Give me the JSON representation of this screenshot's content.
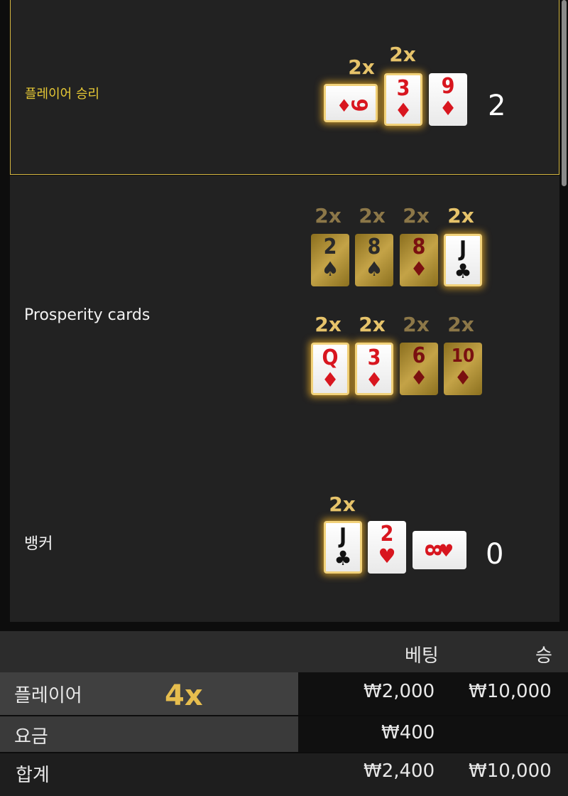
{
  "player": {
    "label": "플레이어 승리",
    "score": "2",
    "multipliers": [
      "2x",
      "2x"
    ],
    "cards": [
      {
        "rank": "9",
        "suit": "♦",
        "color": "red",
        "highlight": true,
        "sideways": true
      },
      {
        "rank": "3",
        "suit": "♦",
        "color": "red",
        "highlight": true
      },
      {
        "rank": "9",
        "suit": "♦",
        "color": "red",
        "highlight": false
      }
    ]
  },
  "prosperity": {
    "label": "Prosperity cards",
    "row1": {
      "multipliers": [
        "2x",
        "2x",
        "2x",
        "2x"
      ],
      "cards": [
        {
          "rank": "2",
          "suit": "♠",
          "color": "black",
          "active": false
        },
        {
          "rank": "8",
          "suit": "♠",
          "color": "black",
          "active": false
        },
        {
          "rank": "8",
          "suit": "♦",
          "color": "red",
          "active": false
        },
        {
          "rank": "J",
          "suit": "♣",
          "color": "black",
          "active": true
        }
      ]
    },
    "row2": {
      "multipliers": [
        "2x",
        "2x",
        "2x",
        "2x"
      ],
      "cards": [
        {
          "rank": "Q",
          "suit": "♦",
          "color": "red",
          "active": true
        },
        {
          "rank": "3",
          "suit": "♦",
          "color": "red",
          "active": true
        },
        {
          "rank": "6",
          "suit": "♦",
          "color": "red",
          "active": false
        },
        {
          "rank": "10",
          "suit": "♦",
          "color": "red",
          "active": false
        }
      ]
    }
  },
  "banker": {
    "label": "뱅커",
    "score": "0",
    "multipliers": [
      "2x"
    ],
    "cards": [
      {
        "rank": "J",
        "suit": "♣",
        "color": "black",
        "highlight": true
      },
      {
        "rank": "2",
        "suit": "♥",
        "color": "red",
        "highlight": false
      },
      {
        "rank": "8",
        "suit": "♥",
        "color": "red",
        "highlight": false,
        "sideways": true
      }
    ]
  },
  "results": {
    "header": {
      "bet": "베팅",
      "win": "승"
    },
    "rows": [
      {
        "label": "플레이어",
        "multiplier": "4x",
        "bet": "₩2,000",
        "win": "₩10,000"
      },
      {
        "label": "요금",
        "bet": "₩400",
        "win": ""
      }
    ],
    "total": {
      "label": "합계",
      "bet": "₩2,400",
      "win": "₩10,000"
    }
  },
  "colors": {
    "gold": "#e6c36a",
    "panel": "#222222",
    "highlight_border": "#d4b640"
  }
}
